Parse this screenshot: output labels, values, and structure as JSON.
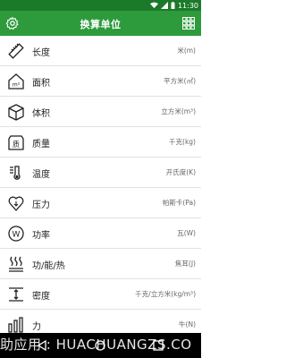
{
  "status_bar": {
    "time": "11:30"
  },
  "app_bar": {
    "title": "换算单位"
  },
  "units": [
    {
      "name": "长度",
      "unit": "米(m)",
      "icon": "ruler-icon"
    },
    {
      "name": "面积",
      "unit": "平方米(㎡)",
      "icon": "area-icon"
    },
    {
      "name": "体积",
      "unit": "立方米(m³)",
      "icon": "cube-icon"
    },
    {
      "name": "质量",
      "unit": "千克(kg)",
      "icon": "weight-icon"
    },
    {
      "name": "温度",
      "unit": "开氏度(K)",
      "icon": "thermometer-icon"
    },
    {
      "name": "压力",
      "unit": "帕斯卡(Pa)",
      "icon": "pressure-icon"
    },
    {
      "name": "功率",
      "unit": "瓦(W)",
      "icon": "power-icon"
    },
    {
      "name": "功/能/热",
      "unit": "焦耳(J)",
      "icon": "heat-icon"
    },
    {
      "name": "密度",
      "unit": "千克/立方米(kg/m³)",
      "icon": "density-icon"
    },
    {
      "name": "力",
      "unit": "牛(N)",
      "icon": "force-icon"
    }
  ],
  "watermark": "助应用 : HUACHUANGZS.CO",
  "colors": {
    "primary": "#2d9a3c",
    "status_bar": "#1b7a2a"
  }
}
